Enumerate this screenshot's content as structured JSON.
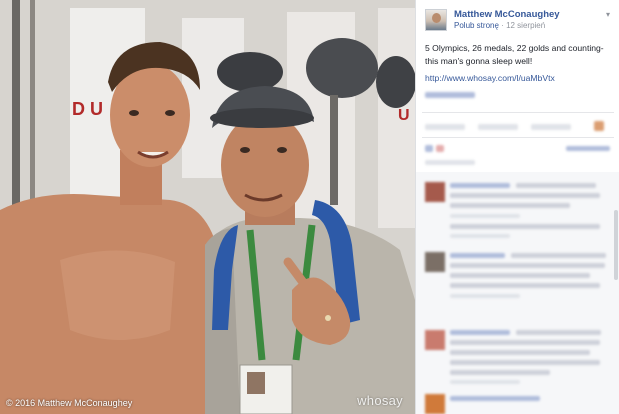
{
  "photo": {
    "credit": "© 2016 Matthew McConaughey",
    "watermark": "whosay",
    "colors": {
      "tent": "#d9d7d3",
      "skin": "#c78a67",
      "sweater": "#b8b4ab",
      "cap": "#4a4d52",
      "backpack": "#2d5aa8",
      "lanyard": "#3c8a3f"
    }
  },
  "post": {
    "author": "Matthew McConaughey",
    "like_page": "Polub stronę",
    "separator": "·",
    "date": "12 sierpień",
    "options_icon": "chevron-down-icon",
    "text": "5 Olympics, 26 medals, 22 golds and counting- this man's gonna sleep well!",
    "link": "http://www.whosay.com/l/uaMbVtx"
  },
  "colors": {
    "link": "#365899",
    "text": "#1d2129",
    "meta": "#90949c",
    "divider": "#e5e6e9",
    "comment_bg": "#f6f7f9"
  }
}
